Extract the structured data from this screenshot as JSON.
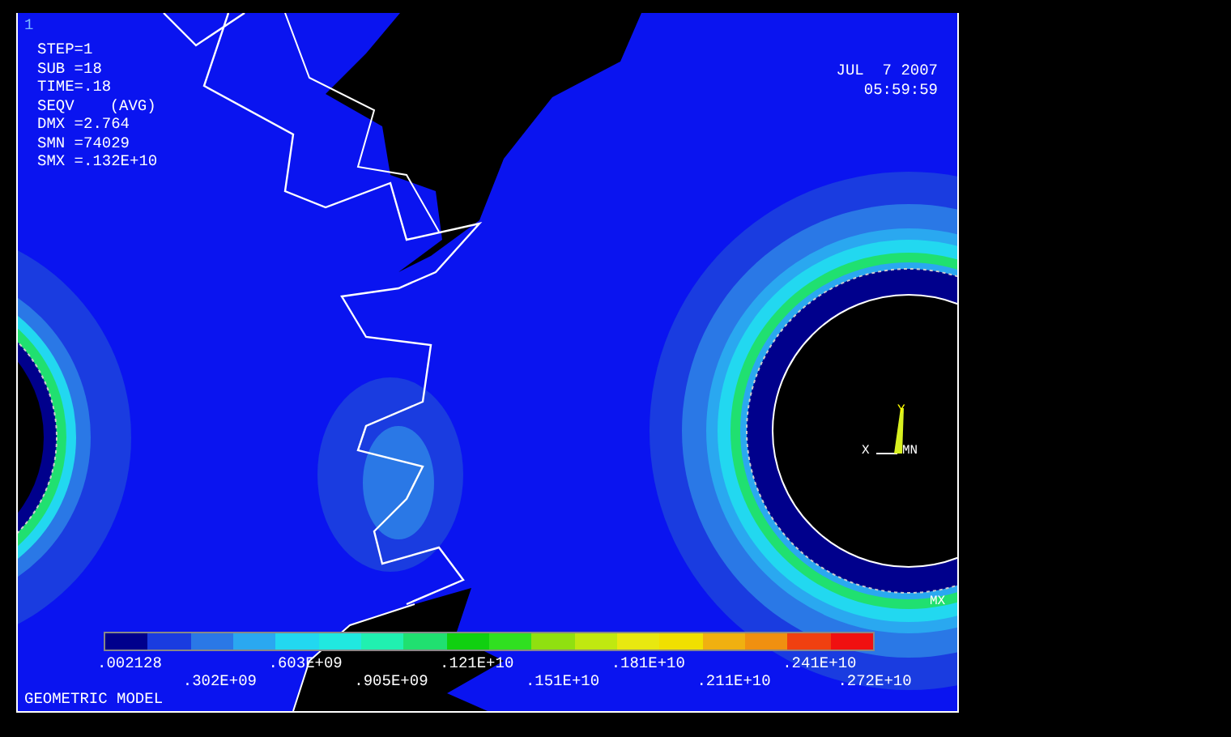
{
  "viewport_number": "1",
  "results": [
    "STEP=1",
    "SUB =18",
    "TIME=.18"
  ],
  "quantity": {
    "name": "SEQV",
    "averaging": "(AVG)"
  },
  "stats": [
    "DMX =2.764",
    "SMN =74029",
    "SMX =.132E+10"
  ],
  "date": "JUL  7 2007",
  "time": "05:59:59",
  "triad": {
    "y": "Y",
    "x": "X",
    "origin": "MN"
  },
  "max_label": "MX",
  "legend": {
    "bands": [
      {
        "color": "#00008c"
      },
      {
        "color": "#1a3ce0"
      },
      {
        "color": "#2a78e6"
      },
      {
        "color": "#2aa8f0"
      },
      {
        "color": "#22d8f0"
      },
      {
        "color": "#20e8e0"
      },
      {
        "color": "#20f0b0"
      },
      {
        "color": "#20e070"
      },
      {
        "color": "#10d010"
      },
      {
        "color": "#30e020"
      },
      {
        "color": "#90e010"
      },
      {
        "color": "#c0e810"
      },
      {
        "color": "#e8e810"
      },
      {
        "color": "#f0e000"
      },
      {
        "color": "#f0b010"
      },
      {
        "color": "#f09010"
      },
      {
        "color": "#f04010"
      },
      {
        "color": "#f01010"
      }
    ],
    "labels": [
      ".002128",
      ".302E+09",
      ".603E+09",
      ".905E+09",
      ".121E+10",
      ".151E+10",
      ".181E+10",
      ".211E+10",
      ".241E+10",
      ".272E+10"
    ]
  },
  "model_label": "GEOMETRIC MODEL"
}
